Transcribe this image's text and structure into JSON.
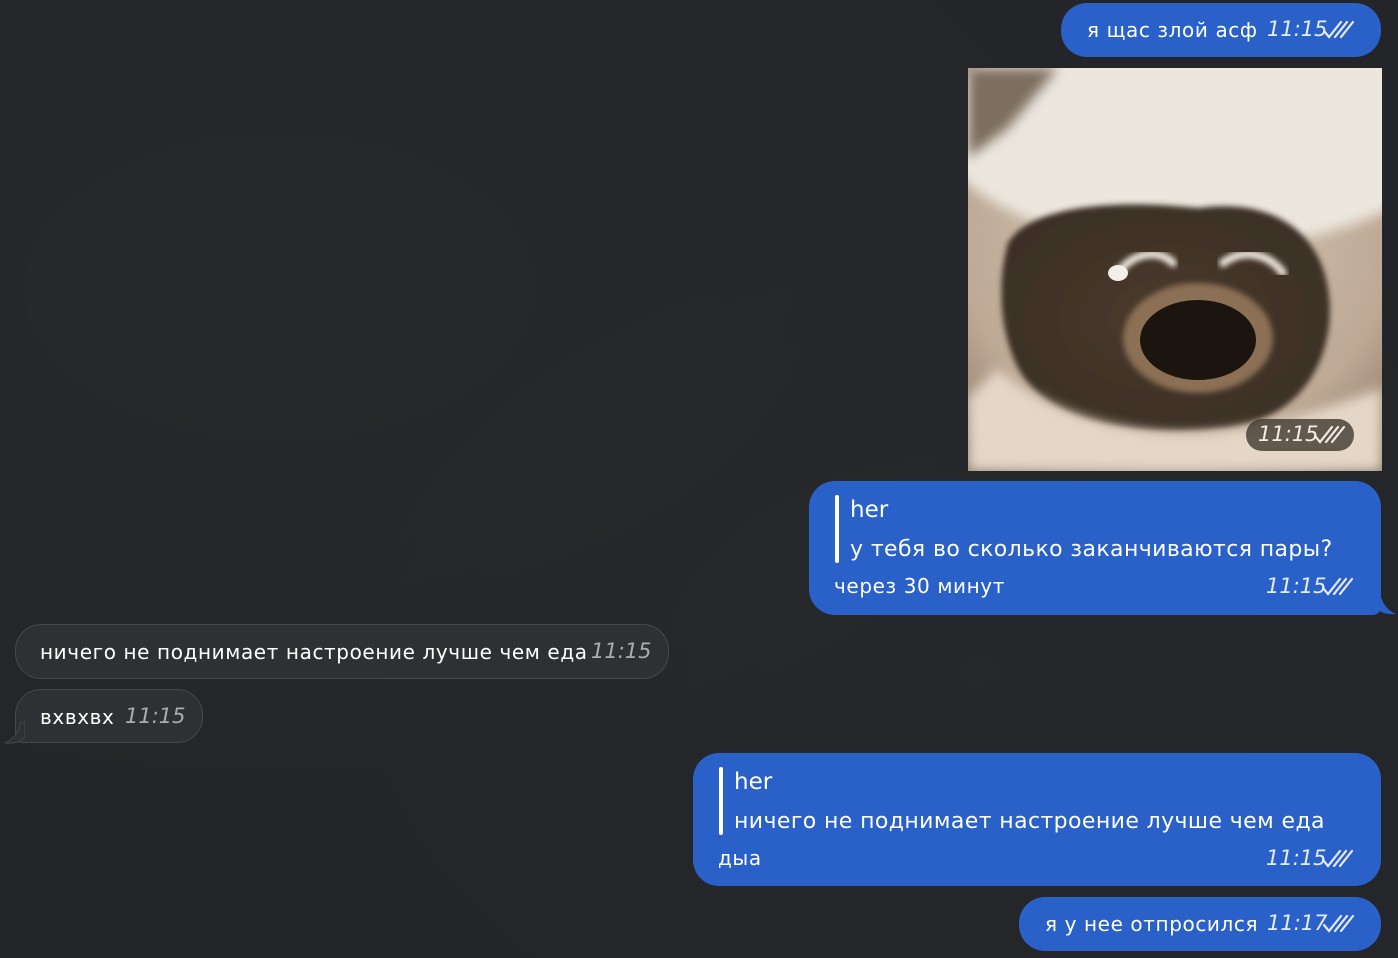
{
  "messages": [
    {
      "text": "я щас злой асф",
      "time": "11:15"
    },
    {
      "time": "11:15"
    },
    {
      "reply_name": "her",
      "reply_text": "у тебя во сколько заканчиваются пары?",
      "text": "через 30 минут",
      "time": "11:15"
    },
    {
      "text": "ничего не поднимает настроение лучше чем еда",
      "time": "11:15"
    },
    {
      "text": "вхвхвх",
      "time": "11:15"
    },
    {
      "reply_name": "her",
      "reply_text": "ничего не поднимает настроение лучше чем еда",
      "text": "дыа",
      "time": "11:15"
    },
    {
      "text": "я у нее отпросился",
      "time": "11:17"
    }
  ],
  "colors": {
    "outgoing_bubble": "#2a61c9",
    "incoming_bubble": "#2e3033",
    "background": "#232528"
  },
  "icons": [
    "double-check-icon"
  ]
}
